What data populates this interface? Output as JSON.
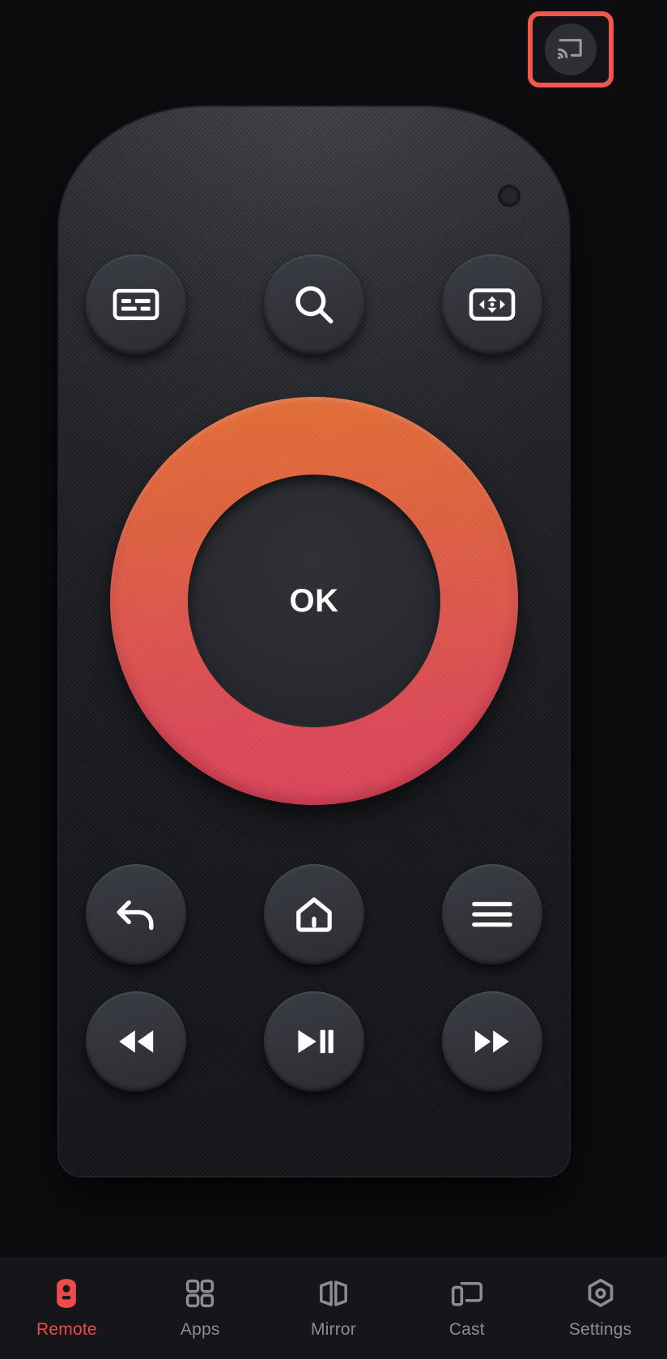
{
  "app": {
    "background_color": "#0d0d10",
    "accent_color": "#ef4b4b",
    "highlight_color": "#f4564e"
  },
  "topbar": {
    "cast_button": {
      "icon": "cast-icon",
      "label": "Cast",
      "highlighted": true,
      "highlight_color": "#f4564e"
    }
  },
  "remote": {
    "indicator": {
      "icon": "ir-indicator-icon"
    },
    "top_row": [
      {
        "id": "keyboard",
        "icon": "keyboard-icon",
        "label": "Keyboard"
      },
      {
        "id": "search",
        "icon": "search-icon",
        "label": "Search"
      },
      {
        "id": "dpad-mode",
        "icon": "dpad-mode-icon",
        "label": "D-Pad Mode"
      }
    ],
    "dpad": {
      "center_label": "OK",
      "ring_color_top": "#e8703a",
      "ring_color_bottom": "#e0485e"
    },
    "nav_row": [
      {
        "id": "back",
        "icon": "back-arrow-icon",
        "label": "Back"
      },
      {
        "id": "home",
        "icon": "home-icon",
        "label": "Home"
      },
      {
        "id": "menu",
        "icon": "menu-icon",
        "label": "Menu"
      }
    ],
    "media_row": [
      {
        "id": "rewind",
        "icon": "rewind-icon",
        "label": "Rewind"
      },
      {
        "id": "play-pause",
        "icon": "play-pause-icon",
        "label": "Play / Pause"
      },
      {
        "id": "fast-forward",
        "icon": "fast-forward-icon",
        "label": "Fast Forward"
      }
    ]
  },
  "bottom_nav": {
    "active": "Remote",
    "items": [
      {
        "id": "remote",
        "label": "Remote",
        "icon": "remote-control-icon",
        "active": true
      },
      {
        "id": "apps",
        "label": "Apps",
        "icon": "apps-grid-icon",
        "active": false
      },
      {
        "id": "mirror",
        "label": "Mirror",
        "icon": "mirror-icon",
        "active": false
      },
      {
        "id": "cast",
        "label": "Cast",
        "icon": "cast-device-icon",
        "active": false
      },
      {
        "id": "settings",
        "label": "Settings",
        "icon": "settings-hexagon-icon",
        "active": false
      }
    ]
  }
}
